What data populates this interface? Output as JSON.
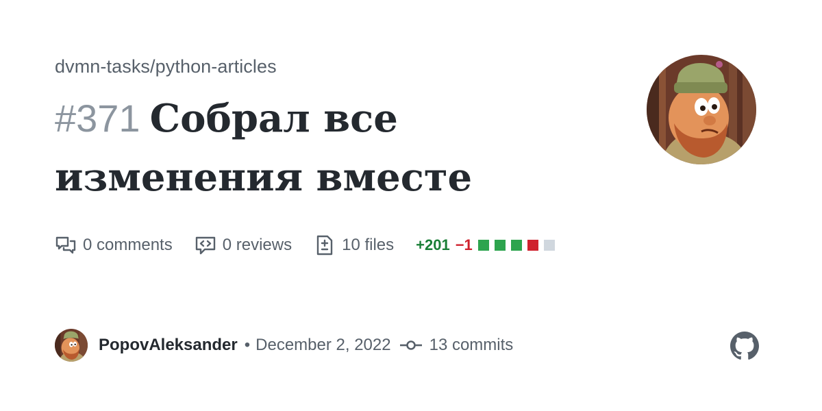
{
  "repo": "dvmn-tasks/python-articles",
  "pr": {
    "number": "#371",
    "title": "Собрал все изменения вместе"
  },
  "stats": {
    "comments": "0 comments",
    "reviews": "0 reviews",
    "files": "10 files",
    "additions": "+201",
    "deletions": "−1",
    "diff_blocks": [
      "added",
      "added",
      "added",
      "deleted",
      "neutral"
    ]
  },
  "footer": {
    "author": "PopovAleksander",
    "separator": "•",
    "date": "December 2, 2022",
    "commits": "13 commits"
  },
  "colors": {
    "added": "#2da44e",
    "deleted": "#cf222e",
    "neutral": "#d0d7de",
    "muted_text": "#57606a",
    "number_text": "#8c959f"
  },
  "icons": {
    "comments": "comment-discussion-icon",
    "reviews": "code-review-icon",
    "files": "file-diff-icon",
    "commits": "git-commit-icon",
    "brand": "github-logo-icon"
  }
}
